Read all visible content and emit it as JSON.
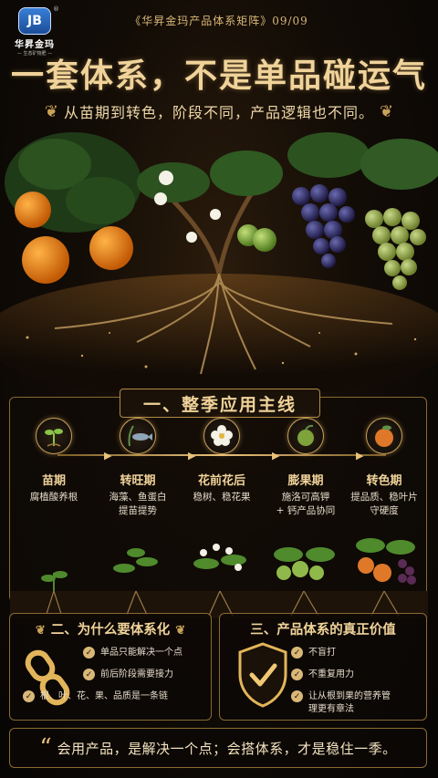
{
  "brand": {
    "logo_text": "JB",
    "name": "华昇金玛",
    "subtitle": "— 生态矿物肥 —",
    "registered": "®"
  },
  "header": {
    "series_tag": "《华昇金玛产品体系矩阵》09/09",
    "headline": "一套体系，不是单品碰运气",
    "subheadline": "从苗期到转色，阶段不同，产品逻辑也不同。"
  },
  "section1": {
    "title": "一、整季应用主线",
    "stages": [
      {
        "name": "苗期",
        "desc": [
          "腐植酸养根"
        ],
        "icon": "sprout-icon"
      },
      {
        "name": "转旺期",
        "desc": [
          "海藻、鱼蛋白",
          "提苗提势"
        ],
        "icon": "fish-seaweed-icon"
      },
      {
        "name": "花前花后",
        "desc": [
          "稳树、稳花果"
        ],
        "icon": "flower-icon"
      },
      {
        "name": "膨果期",
        "desc": [
          "施洛可高钾",
          "+ 钙产品协同"
        ],
        "icon": "fruit-icon"
      },
      {
        "name": "转色期",
        "desc": [
          "提品质、稳叶片",
          "守硬度"
        ],
        "icon": "orange-icon"
      }
    ]
  },
  "section2": {
    "title": "二、为什么要体系化",
    "icon": "chain-icon",
    "items": [
      "单品只能解决一个点",
      "前后阶段需要接力",
      "根、叶、花、果、品质是一条链"
    ]
  },
  "section3": {
    "title": "三、产品体系的真正价值",
    "icon": "shield-check-icon",
    "items": [
      "不盲打",
      "不重复用力",
      "让从根到果的营养管理更有章法"
    ]
  },
  "quote": {
    "text": "会用产品，是解决一个点；会搭体系，才是稳住一季。"
  },
  "colors": {
    "gold": "#e9c27a",
    "background": "#0b0806",
    "text_light": "#f3e3c0"
  }
}
